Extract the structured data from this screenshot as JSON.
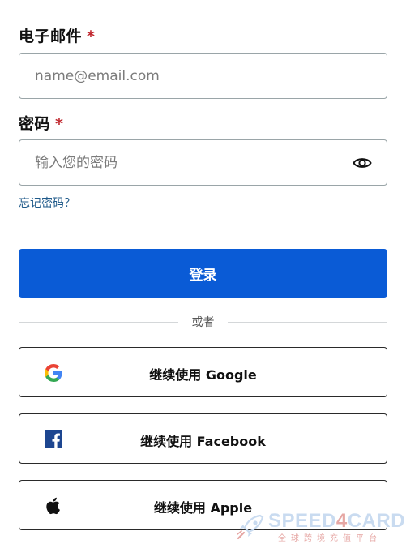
{
  "email": {
    "label": "电子邮件",
    "required_mark": "*",
    "placeholder": "name@email.com",
    "value": ""
  },
  "password": {
    "label": "密码",
    "required_mark": "*",
    "placeholder": "输入您的密码",
    "value": "",
    "toggle_icon": "eye-icon"
  },
  "forgot_password": "忘记密码？",
  "login_button": "登录",
  "divider_text": "或者",
  "social": [
    {
      "label": "继续使用 Google",
      "icon": "google-icon"
    },
    {
      "label": "继续使用 Facebook",
      "icon": "facebook-icon"
    },
    {
      "label": "继续使用 Apple",
      "icon": "apple-icon"
    }
  ],
  "watermark": {
    "brand_a": "SPEED",
    "brand_b": "4",
    "brand_c": "CARD",
    "subtitle": "全球跨境充值平台"
  },
  "colors": {
    "primary": "#0a5bd6",
    "required": "#c0262d",
    "link": "#1f5a8a"
  }
}
